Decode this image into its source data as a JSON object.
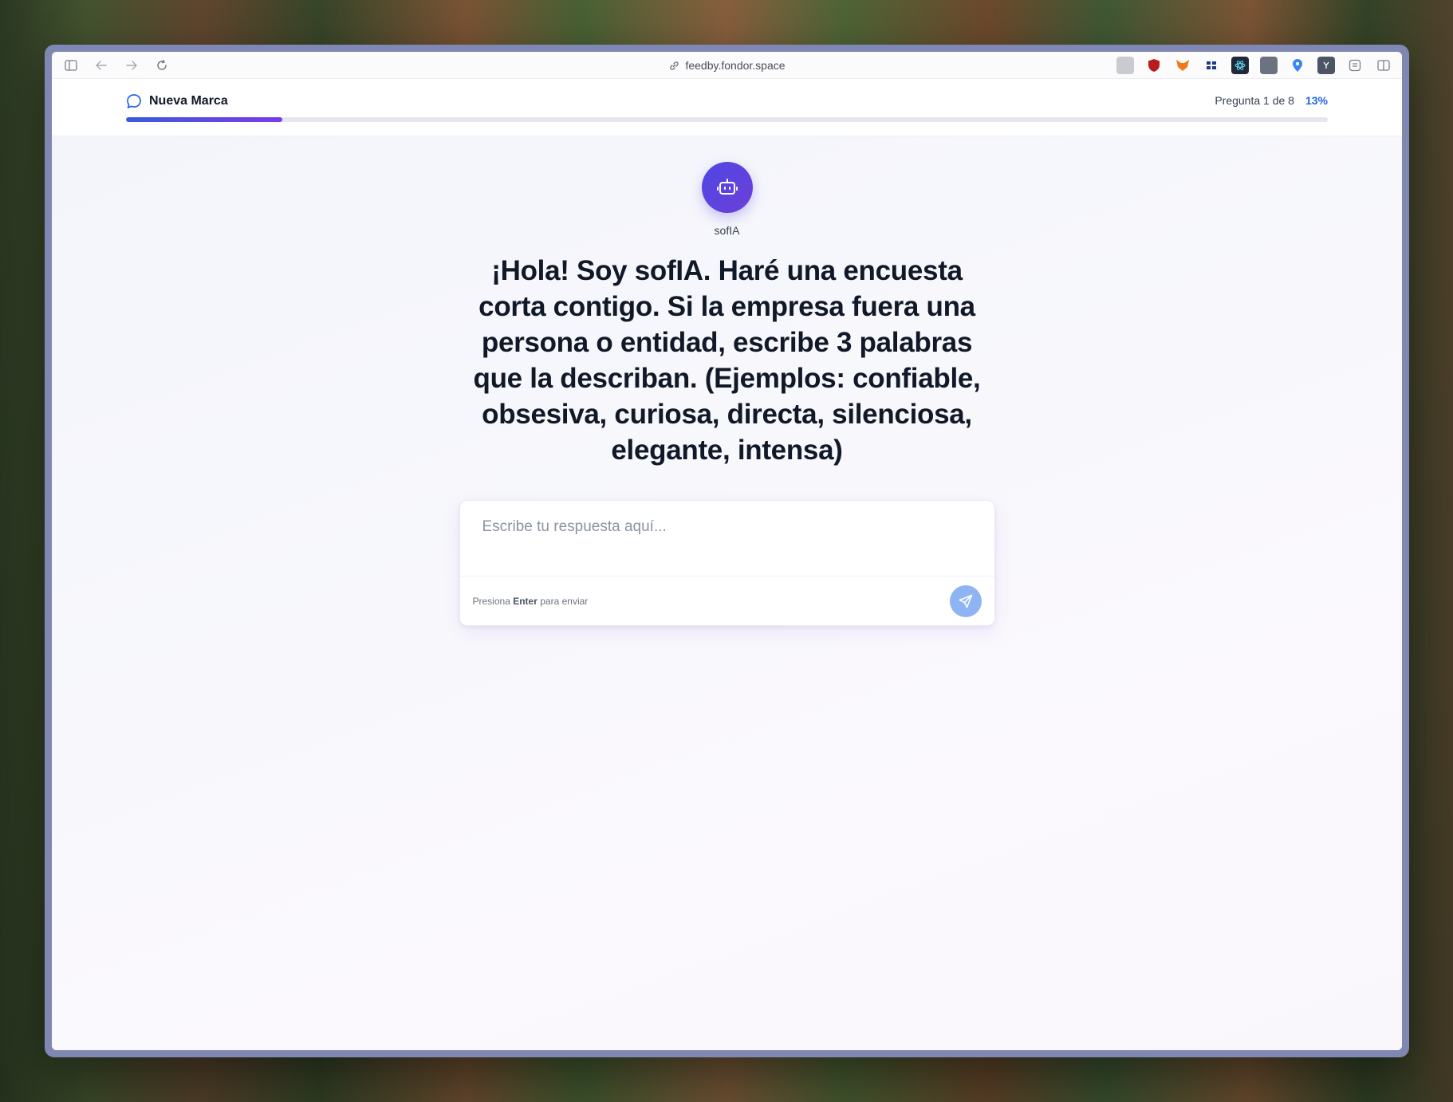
{
  "browser": {
    "url": "feedby.fondor.space"
  },
  "header": {
    "title": "Nueva Marca",
    "progress_text": "Pregunta 1 de 8",
    "progress_pct": "13%",
    "progress_value": 0.13
  },
  "bot": {
    "name": "sofIA"
  },
  "question": {
    "text": "¡Hola! Soy sofIA. Haré una encuesta corta contigo. Si la empresa fuera una persona o entidad, escribe 3 palabras que la describan. (Ejemplos: confiable, obsesiva, curiosa, directa, silenciosa, elegante, intensa)"
  },
  "answer": {
    "placeholder": "Escribe tu respuesta aquí...",
    "hint_prefix": "Presiona",
    "hint_key": "Enter",
    "hint_suffix": "para enviar"
  },
  "colors": {
    "accent": "#2563eb",
    "avatar": "#4f46e5",
    "send": "#8fb4f4"
  }
}
